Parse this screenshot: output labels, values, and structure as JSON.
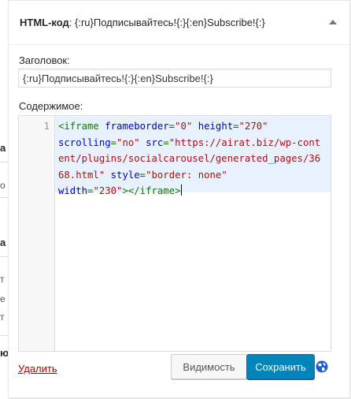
{
  "widget": {
    "title_main": "HTML-код",
    "title_sub": ": {:ru}Подписывайтесь!{:}{:en}Subscribe!{:}",
    "title_label": "Заголовок:",
    "title_value": "{:ru}Подписывайтесь!{:}{:en}Subscribe!{:}",
    "content_label": "Содержимое:",
    "editor": {
      "line_number": "1",
      "tokens": {
        "open_tag": "<iframe",
        "attr_frameborder": "frameborder",
        "eq": "=",
        "val_frameborder": "\"0\"",
        "attr_height": "height",
        "val_height": "\"270\"",
        "attr_scrolling": "scrolling",
        "val_scrolling": "\"no\"",
        "attr_src": "src",
        "val_src": "\"https://airat.biz/wp-content/plugins/socialcarousel/generated_pages/3668.html\"",
        "attr_style": "style",
        "val_style": "\"border: none\"",
        "attr_width": "width",
        "val_width": "\"230\"",
        "close_tag": "></iframe>"
      }
    },
    "delete_label": "Удалить",
    "visibility_label": "Видимость",
    "save_label": "Сохранить"
  },
  "left_panel": {
    "fragments": [
      "а",
      "о",
      "а",
      "т",
      "е",
      "т",
      "ю"
    ]
  },
  "colors": {
    "save_button": "#0085ba",
    "delete_link": "#aa0000",
    "editor_highlight": "#e8f2ff",
    "globe_icon": "#1e5bd6"
  }
}
